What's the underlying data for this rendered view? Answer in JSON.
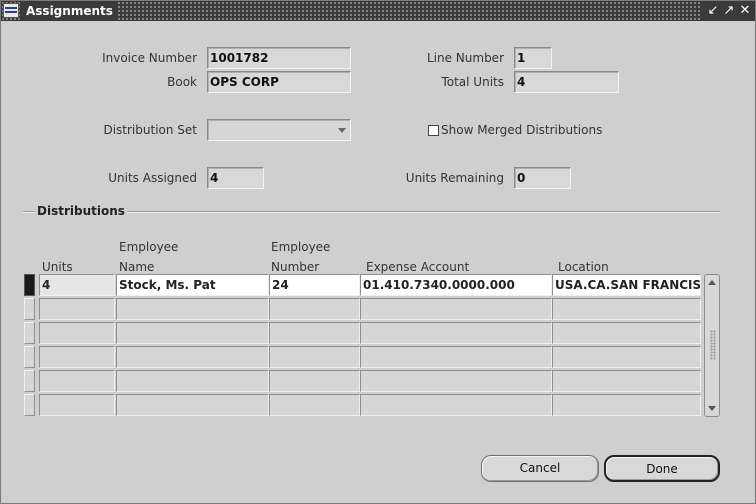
{
  "window": {
    "title": "Assignments"
  },
  "header": {
    "invoice_number_label": "Invoice Number",
    "invoice_number": "1001782",
    "line_number_label": "Line Number",
    "line_number": "1",
    "book_label": "Book",
    "book": "OPS CORP",
    "total_units_label": "Total Units",
    "total_units": "4",
    "distribution_set_label": "Distribution Set",
    "distribution_set": "",
    "show_merged_label": "Show Merged Distributions",
    "show_merged_checked": false,
    "units_assigned_label": "Units Assigned",
    "units_assigned": "4",
    "units_remaining_label": "Units Remaining",
    "units_remaining": "0"
  },
  "distributions": {
    "section_label": "Distributions",
    "columns": {
      "units": "Units",
      "employee_name_1": "Employee",
      "employee_name_2": "Name",
      "employee_number_1": "Employee",
      "employee_number_2": "Number",
      "expense_account": "Expense Account",
      "location": "Location"
    },
    "rows": [
      {
        "units": "4",
        "employee_name": "Stock, Ms. Pat",
        "employee_number": "24",
        "expense_account": "01.410.7340.0000.000",
        "location": "USA.CA.SAN FRANCISCO"
      },
      {
        "units": "",
        "employee_name": "",
        "employee_number": "",
        "expense_account": "",
        "location": ""
      },
      {
        "units": "",
        "employee_name": "",
        "employee_number": "",
        "expense_account": "",
        "location": ""
      },
      {
        "units": "",
        "employee_name": "",
        "employee_number": "",
        "expense_account": "",
        "location": ""
      },
      {
        "units": "",
        "employee_name": "",
        "employee_number": "",
        "expense_account": "",
        "location": ""
      },
      {
        "units": "",
        "employee_name": "",
        "employee_number": "",
        "expense_account": "",
        "location": ""
      }
    ]
  },
  "buttons": {
    "cancel": "Cancel",
    "done": "Done"
  },
  "colors": {
    "titlebar": "#3a3a3a",
    "window_bg": "#cfcfcf",
    "field_bg": "#d8d8d8",
    "active_row": "#ffffff"
  }
}
